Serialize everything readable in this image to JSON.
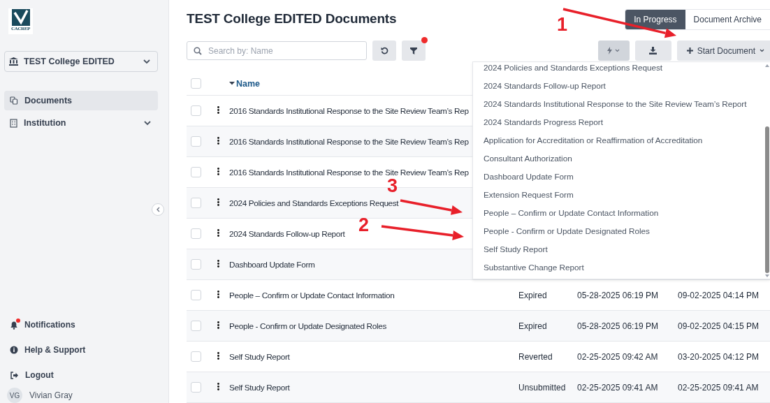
{
  "logo": {
    "text": "CACREP"
  },
  "sidebar": {
    "institution_select": {
      "value": "TEST College EDITED"
    },
    "nav": [
      {
        "label": "Documents",
        "selected": true,
        "expandable": false
      },
      {
        "label": "Institution",
        "selected": false,
        "expandable": true
      }
    ],
    "bottom": [
      {
        "label": "Notifications",
        "badge": true
      },
      {
        "label": "Help & Support",
        "badge": false
      },
      {
        "label": "Logout",
        "badge": false
      }
    ],
    "user": {
      "initials": "VG",
      "name": "Vivian Gray"
    }
  },
  "page_title": "TEST College EDITED Documents",
  "tabs": [
    {
      "label": "In Progress",
      "selected": true
    },
    {
      "label": "Document Archive",
      "selected": false
    }
  ],
  "search": {
    "placeholder": "Search by: Name"
  },
  "filter_active": true,
  "start_button": {
    "label": "Start Document"
  },
  "table": {
    "header_checked": false,
    "columns": [
      {
        "label": "Name",
        "sorted": true
      }
    ],
    "rows": [
      {
        "checked": false,
        "name": "2016 Standards Institutional Response to the Site Review Team’s Rep"
      },
      {
        "checked": false,
        "name": "2016 Standards Institutional Response to the Site Review Team’s Rep"
      },
      {
        "checked": false,
        "name": "2016 Standards Institutional Response to the Site Review Team’s Rep"
      },
      {
        "checked": false,
        "name": "2024 Policies and Standards Exceptions Request"
      },
      {
        "checked": false,
        "name": "2024 Standards Follow-up Report"
      },
      {
        "checked": false,
        "name": "Dashboard Update Form"
      },
      {
        "checked": false,
        "name": "People – Confirm or Update Contact Information",
        "column_3": "Expired",
        "column_4": "05-28-2025 06:19 PM",
        "column_5": "09-02-2025 04:14 PM"
      },
      {
        "checked": false,
        "name": "People - Confirm or Update Designated Roles",
        "column_3": "Expired",
        "column_4": "05-28-2025 06:19 PM",
        "column_5": "09-02-2025 04:15 PM"
      },
      {
        "checked": false,
        "name": "Self Study Report",
        "column_3": "Reverted",
        "column_4": "02-25-2025 09:42 AM",
        "column_5": "03-20-2025 04:12 PM"
      },
      {
        "checked": false,
        "name": "Self Study Report",
        "column_3": "Unsubmitted",
        "column_4": "02-25-2025 09:41 AM",
        "column_5": "02-25-2025 09:41 AM"
      }
    ]
  },
  "dropdown": {
    "items": [
      "2024 Policies and Standards Exceptions Request",
      "2024 Standards Follow-up Report",
      "2024 Standards Institutional Response to the Site Review Team’s Report",
      "2024 Standards Progress Report",
      "Application for Accreditation or Reaffirmation of Accreditation",
      "Consultant Authorization",
      "Dashboard Update Form",
      "Extension Request Form",
      "People – Confirm or Update Contact Information",
      "People - Confirm or Update Designated Roles",
      "Self Study Report",
      "Substantive Change Report"
    ]
  },
  "annotations": [
    {
      "label": "1"
    },
    {
      "label": "3"
    },
    {
      "label": "2"
    }
  ]
}
